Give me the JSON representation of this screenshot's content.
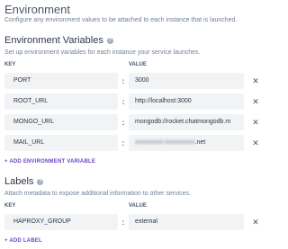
{
  "environment": {
    "title": "Environment",
    "description": "Configure any environment values to be attached to each instance that is launched."
  },
  "env_vars": {
    "title": "Environment Variables",
    "description": "Set up environment variables for each instance your service launches.",
    "key_header": "KEY",
    "value_header": "VALUE",
    "separator": ":",
    "remove_glyph": "✕",
    "rows": [
      {
        "key": "PORT",
        "value": "3000"
      },
      {
        "key": "ROOT_URL",
        "value": "http://localhost:3000"
      },
      {
        "key": "MONGO_URL",
        "value": "mongodb://rocket.chatmongodb.m"
      },
      {
        "key": "MAIL_URL",
        "value_blurred": "xxxxxxxxx.lxxxxxxxxx",
        "value_suffix": ".net"
      }
    ],
    "add_label": "+ ADD ENVIRONMENT VARIABLE"
  },
  "labels": {
    "title": "Labels",
    "description": "Attach metadata to expose additional information to other services.",
    "key_header": "KEY",
    "value_header": "VALUE",
    "separator": ":",
    "remove_glyph": "✕",
    "rows": [
      {
        "key": "HAPROXY_GROUP",
        "value": "external"
      }
    ],
    "add_label": "+ ADD LABEL"
  },
  "icons": {
    "help": "help-circle-icon",
    "remove": "close-icon"
  },
  "colors": {
    "accent": "#6b46c1",
    "field_bg": "#f1f3f5"
  }
}
